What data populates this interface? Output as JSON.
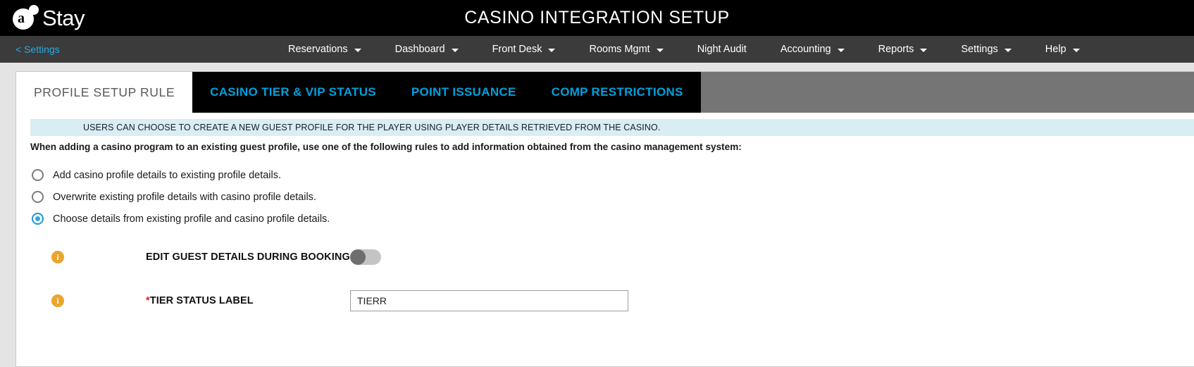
{
  "header": {
    "logo_letter": "a",
    "logo_text": "Stay",
    "title": "CASINO INTEGRATION SETUP"
  },
  "nav": {
    "back_label": "< Settings",
    "items": [
      {
        "label": "Reservations",
        "has_caret": true
      },
      {
        "label": "Dashboard",
        "has_caret": true
      },
      {
        "label": "Front Desk",
        "has_caret": true
      },
      {
        "label": "Rooms Mgmt",
        "has_caret": true
      },
      {
        "label": "Night Audit",
        "has_caret": false
      },
      {
        "label": "Accounting",
        "has_caret": true
      },
      {
        "label": "Reports",
        "has_caret": true
      },
      {
        "label": "Settings",
        "has_caret": true
      },
      {
        "label": "Help",
        "has_caret": true
      }
    ]
  },
  "tabs": [
    {
      "label": "PROFILE SETUP RULE",
      "active": true
    },
    {
      "label": "CASINO TIER & VIP STATUS",
      "active": false
    },
    {
      "label": "POINT ISSUANCE",
      "active": false
    },
    {
      "label": "COMP RESTRICTIONS",
      "active": false
    }
  ],
  "content": {
    "info_banner": "USERS CAN CHOOSE TO CREATE A NEW GUEST PROFILE FOR THE PLAYER USING PLAYER DETAILS RETRIEVED FROM THE CASINO.",
    "lead_text": "When adding a casino program to an existing guest profile, use one of the following rules to add information obtained from the casino management system:",
    "radio_options": [
      {
        "label": "Add casino profile details to existing profile details.",
        "selected": false
      },
      {
        "label": "Overwrite existing profile details with casino profile details.",
        "selected": false
      },
      {
        "label": "Choose details from existing profile and casino profile details.",
        "selected": true
      }
    ],
    "toggle_field": {
      "info_icon": "info-icon",
      "label": "EDIT GUEST DETAILS DURING BOOKING",
      "state": "off"
    },
    "tier_field": {
      "info_icon": "info-icon",
      "required_marker": "*",
      "label": "TIER STATUS LABEL",
      "value": "TIERR",
      "placeholder": ""
    }
  },
  "colors": {
    "accent_blue": "#00a0dc",
    "link_blue": "#29a8df",
    "header_black": "#000000",
    "nav_gray": "#3b3b3b",
    "banner_blue": "#daecf4",
    "info_orange": "#eaa52c",
    "required_red": "#e02020"
  }
}
